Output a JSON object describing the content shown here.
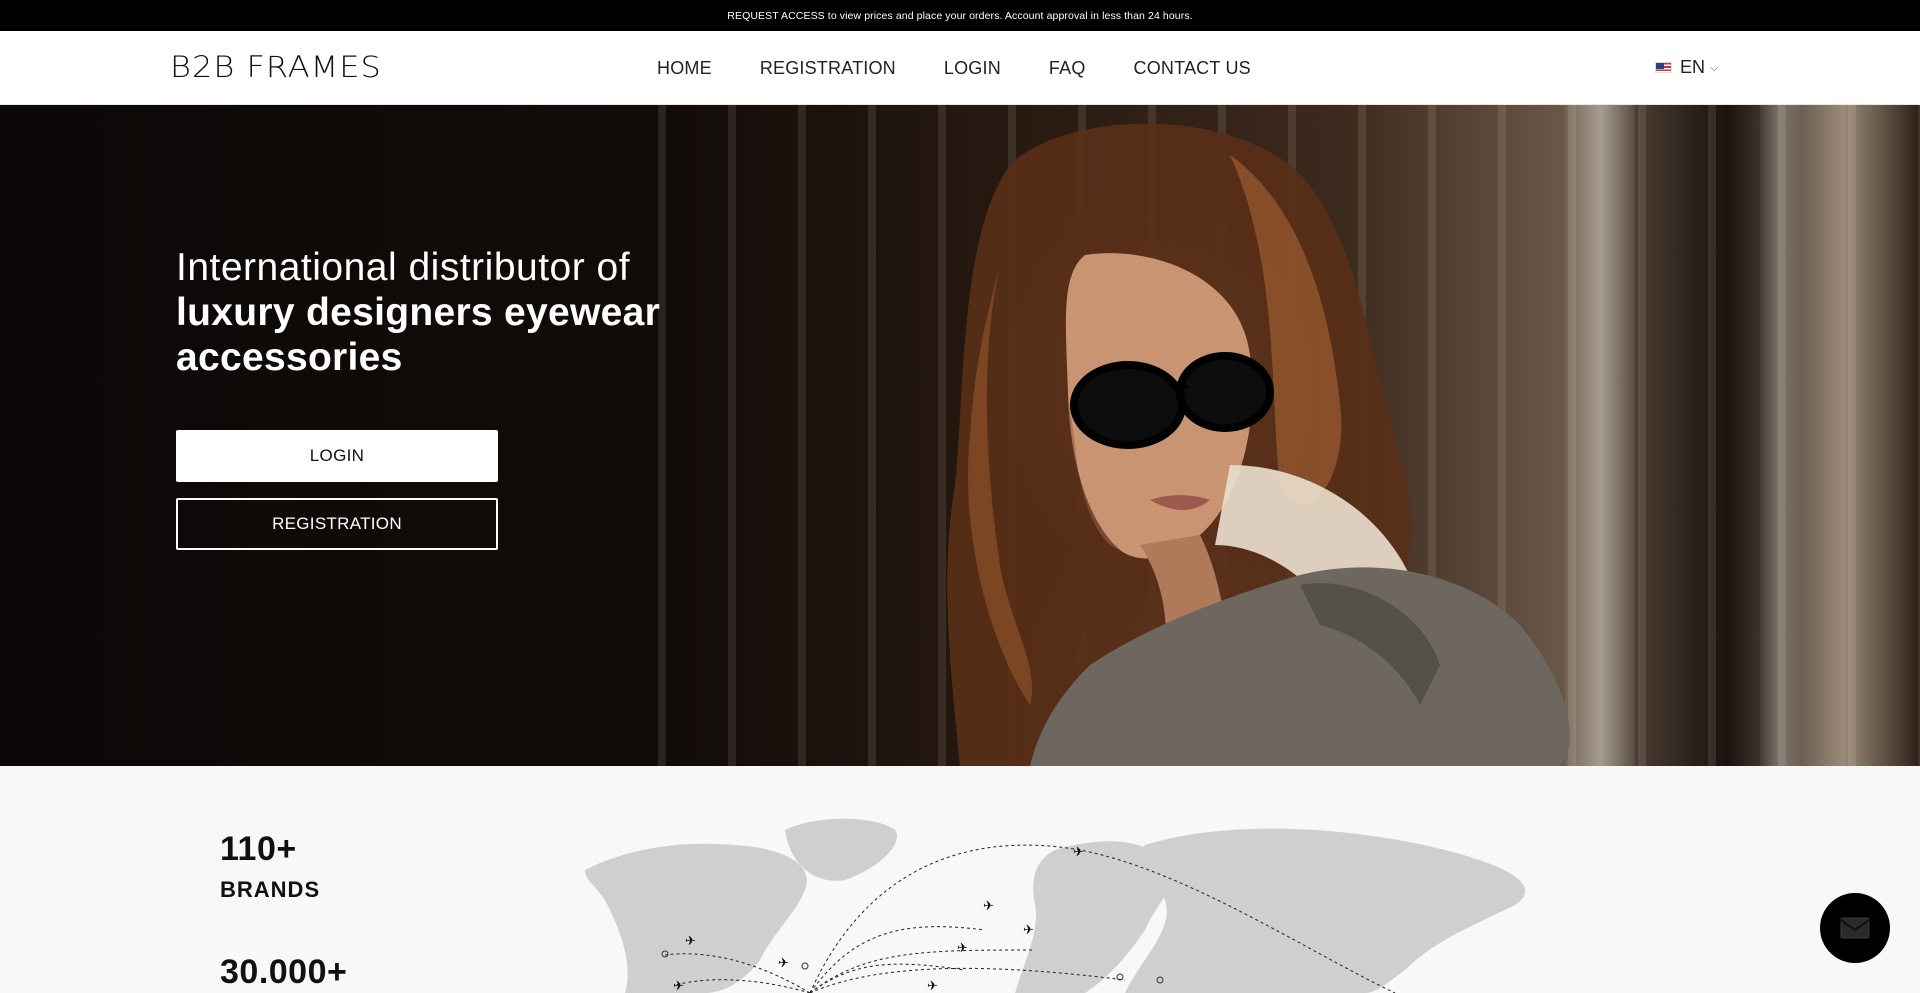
{
  "topbar": {
    "notice": "REQUEST ACCESS to view prices and place your orders. Account approval in less than 24 hours."
  },
  "header": {
    "logo": "B2B FRAMES",
    "nav": [
      "HOME",
      "REGISTRATION",
      "LOGIN",
      "FAQ",
      "CONTACT US"
    ],
    "language": "EN",
    "language_icon": "us-flag-icon"
  },
  "hero": {
    "line1": "International distributor of",
    "line2": "luxury designers eyewear",
    "line3": "accessories",
    "login_label": "LOGIN",
    "registration_label": "REGISTRATION"
  },
  "stats": [
    {
      "value": "110+",
      "label": "BRANDS"
    },
    {
      "value": "30.000+",
      "label": ""
    }
  ],
  "chat": {
    "icon": "envelope-icon"
  },
  "colors": {
    "topbar": "#000000",
    "header": "#ffffff",
    "stats_bg": "#f7f8fa",
    "map_land": "#cccccc"
  }
}
